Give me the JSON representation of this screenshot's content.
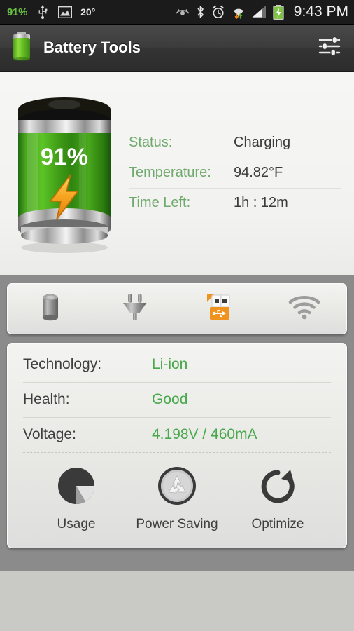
{
  "statusbar": {
    "battery_percent": "91%",
    "temperature": "20°",
    "time": "9:43 PM",
    "left_icons": [
      "usb-icon",
      "image-icon"
    ],
    "right_icons": [
      "eye-off-icon",
      "bluetooth-icon",
      "alarm-icon",
      "wifi-transfer-icon",
      "signal-icon",
      "battery-charging-icon"
    ],
    "accent_green": "#6ac045",
    "background": "#1b1b1b"
  },
  "actionbar": {
    "title": "Battery Tools",
    "app_icon": "battery-icon",
    "settings_icon": "sliders-icon"
  },
  "hero": {
    "battery_level_label": "91%",
    "battery_level_value": 91,
    "charging_icon": "lightning-bolt-icon",
    "rows": [
      {
        "label": "Status:",
        "value": "Charging"
      },
      {
        "label": "Temperature:",
        "value": "94.82°F"
      },
      {
        "label": "Time Left:",
        "value": "1h : 12m"
      }
    ],
    "label_color": "#6fa96c",
    "value_color": "#3b3b3b"
  },
  "connections": {
    "items": [
      {
        "name": "battery-source-icon",
        "label": "Battery",
        "active": false
      },
      {
        "name": "ac-plug-icon",
        "label": "AC",
        "active": false
      },
      {
        "name": "usb-drive-icon",
        "label": "USB",
        "active": true
      },
      {
        "name": "wifi-icon",
        "label": "Wi-Fi",
        "active": false
      }
    ],
    "active_color": "#f0921e",
    "inactive_color": "#9a9a9a"
  },
  "details": {
    "rows": [
      {
        "label": "Technology:",
        "value": "Li-ion"
      },
      {
        "label": "Health:",
        "value": "Good"
      },
      {
        "label": "Voltage:",
        "value": "4.198V / 460mA"
      }
    ],
    "label_color": "#3f3f3f",
    "value_color": "#49a84c"
  },
  "actions": {
    "items": [
      {
        "label": "Usage",
        "icon": "pie-chart-icon"
      },
      {
        "label": "Power Saving",
        "icon": "recycle-icon"
      },
      {
        "label": "Optimize",
        "icon": "refresh-icon"
      }
    ]
  }
}
